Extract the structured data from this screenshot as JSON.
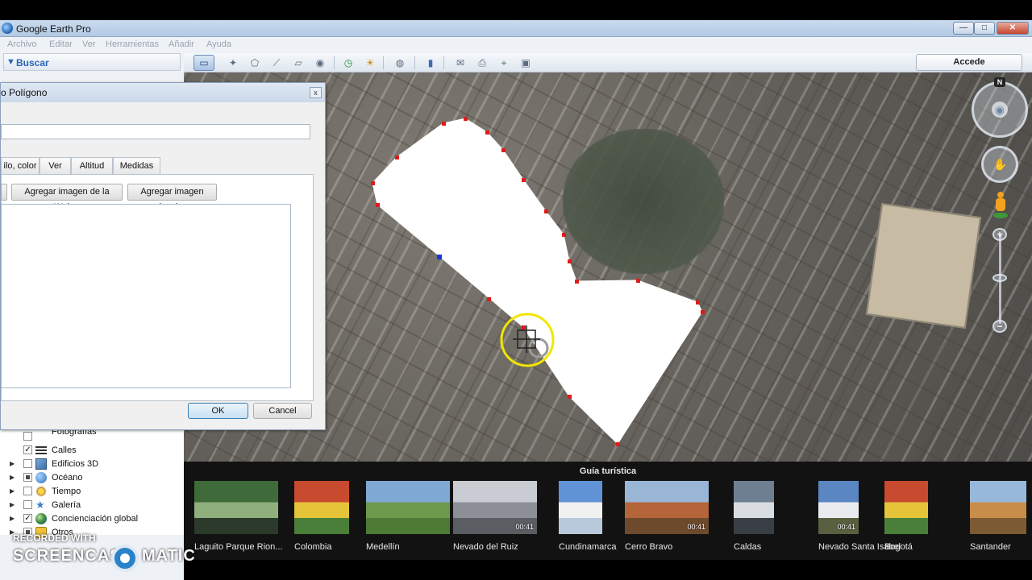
{
  "window": {
    "title": "Google Earth Pro",
    "minimize": "—",
    "maximize": "□",
    "close": "✕"
  },
  "menu": [
    "Archivo",
    "Editar",
    "Ver",
    "Herramientas",
    "Añadir",
    "Ayuda"
  ],
  "toolbar": {
    "login_label": "Accede",
    "icons": [
      "sidebar-toggle-icon",
      "placemark-icon",
      "polygon-icon",
      "path-icon",
      "image-overlay-icon",
      "record-tour-icon",
      "historical-imagery-icon",
      "sunlight-icon",
      "planets-icon",
      "ruler-icon",
      "email-icon",
      "print-icon",
      "google-maps-icon",
      "save-image-icon"
    ]
  },
  "sidebar": {
    "search_label": "Buscar",
    "layers": [
      {
        "label": "Fotografías",
        "checked": false,
        "expandable": false
      },
      {
        "label": "Calles",
        "checked": true,
        "expandable": false
      },
      {
        "label": "Edificios 3D",
        "checked": false,
        "expandable": true
      },
      {
        "label": "Océano",
        "checked": "partial",
        "expandable": true
      },
      {
        "label": "Tiempo",
        "checked": false,
        "expandable": true
      },
      {
        "label": "Galería",
        "checked": false,
        "expandable": true
      },
      {
        "label": "Concienciación global",
        "checked": true,
        "expandable": true
      },
      {
        "label": "Otros",
        "checked": "partial",
        "expandable": true
      }
    ]
  },
  "dialog": {
    "title": "o Polígono",
    "name_value": "",
    "tabs": [
      "ilo, color",
      "Ver",
      "Altitud",
      "Medidas"
    ],
    "add_web_image": "Agregar imagen de la Web...",
    "add_local_image": "Agregar imagen local...",
    "close_label": "x",
    "ok_label": "OK",
    "cancel_label": "Cancel"
  },
  "navigation": {
    "north_label": "N",
    "zoom_in": "+",
    "zoom_out": "−"
  },
  "tour_guide": {
    "title": "Guía turística",
    "items": [
      {
        "caption": "Laguito Parque Rion...",
        "duration": "",
        "colors": [
          "#3f6b3a",
          "#8fb07d",
          "#2b3a2a"
        ]
      },
      {
        "caption": "Colombia",
        "duration": "",
        "colors": [
          "#c84a2f",
          "#e6c43a",
          "#4a7f3a"
        ]
      },
      {
        "caption": "Medellín",
        "duration": "",
        "colors": [
          "#7fa8d4",
          "#6e9a4b",
          "#4d7b36"
        ]
      },
      {
        "caption": "Nevado del Ruiz",
        "duration": "00:41",
        "colors": [
          "#c9cdd3",
          "#8c9096",
          "#5a5e63"
        ]
      },
      {
        "caption": "Cundinamarca",
        "duration": "",
        "colors": [
          "#5f93d6",
          "#f1f1f1",
          "#b9c9dc"
        ]
      },
      {
        "caption": "Cerro Bravo",
        "duration": "00:41",
        "colors": [
          "#9ab6d6",
          "#b5653a",
          "#6e4a2c"
        ]
      },
      {
        "caption": "Caldas",
        "duration": "",
        "colors": [
          "#6f7f92",
          "#d9dde2",
          "#3a3f46"
        ]
      },
      {
        "caption": "Nevado Santa Isabel",
        "duration": "00:41",
        "colors": [
          "#5a86c2",
          "#e9ecef",
          "#58603f"
        ]
      },
      {
        "caption": "Bogotá",
        "duration": "",
        "colors": [
          "#c84a2f",
          "#e6c43a",
          "#4a7f3a"
        ]
      },
      {
        "caption": "Santander",
        "duration": "",
        "colors": [
          "#97b8da",
          "#c98d4a",
          "#7b5a34"
        ]
      }
    ]
  },
  "watermark": {
    "line1": "RECORDED WITH",
    "line2": "SCREENCAST",
    "line3": "MATIC"
  },
  "colors": {
    "polygon_fill": "#ffffff",
    "polygon_vertex": "#e11b1b",
    "selected_vertex": "#1b35d6",
    "cursor_highlight": "#f2e600",
    "accent": "#2966b8"
  }
}
